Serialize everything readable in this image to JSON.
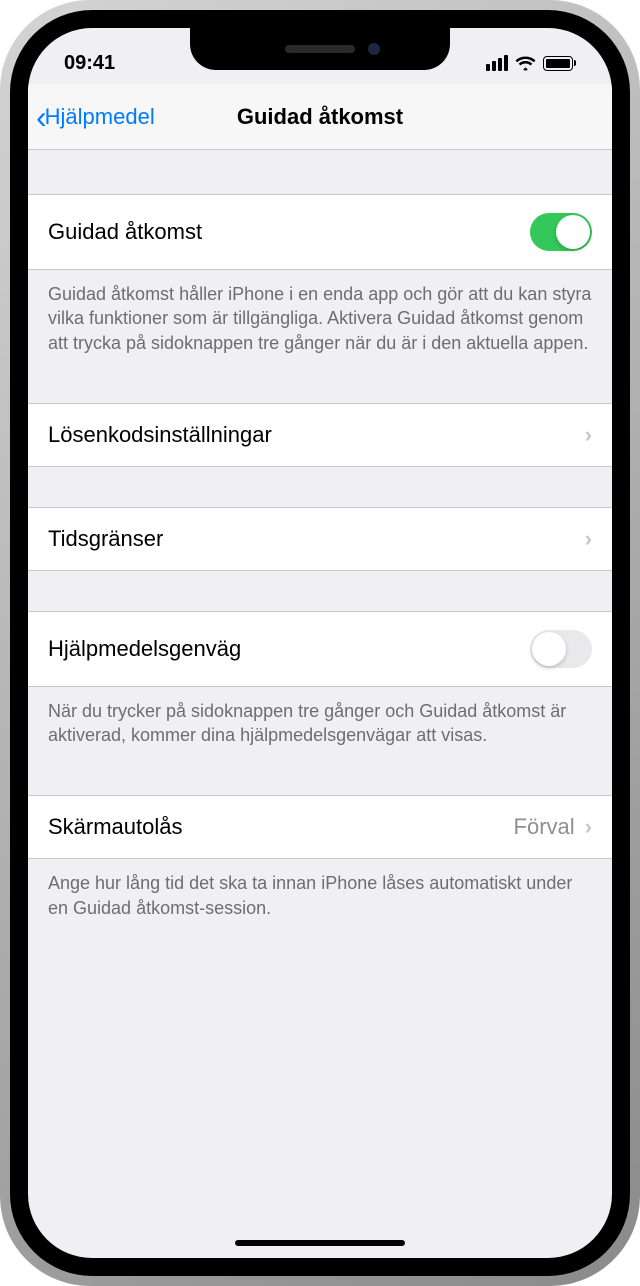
{
  "statusBar": {
    "time": "09:41"
  },
  "nav": {
    "backLabel": "Hjälpmedel",
    "title": "Guidad åtkomst"
  },
  "rows": {
    "guidedAccess": {
      "label": "Guidad åtkomst",
      "footer": "Guidad åtkomst håller iPhone i en enda app och gör att du kan styra vilka funktioner som är tillgängliga. Aktivera Guidad åtkomst genom att trycka på sidoknappen tre gånger när du är i den aktuella appen.",
      "enabled": true
    },
    "passcode": {
      "label": "Lösenkodsinställningar"
    },
    "timeLimits": {
      "label": "Tidsgränser"
    },
    "accessibilityShortcut": {
      "label": "Hjälpmedelsgenväg",
      "footer": "När du trycker på sidoknappen tre gånger och Guidad åtkomst är aktiverad, kommer dina hjälpmedelsgenvägar att visas.",
      "enabled": false
    },
    "autoLock": {
      "label": "Skärmautolås",
      "value": "Förval",
      "footer": "Ange hur lång tid det ska ta innan iPhone låses automatiskt under en Guidad åtkomst-session."
    }
  }
}
